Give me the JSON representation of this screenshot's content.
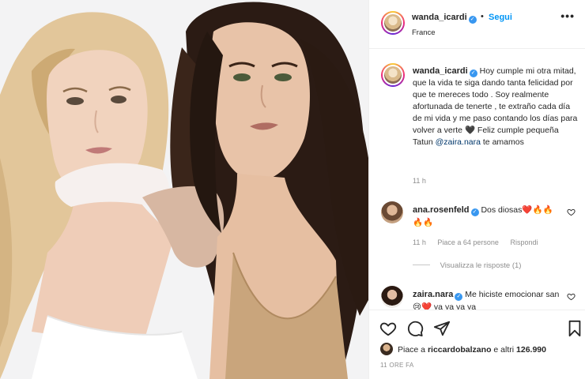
{
  "header": {
    "username": "wanda_icardi",
    "separator": "•",
    "follow_label": "Segui",
    "location": "France",
    "more_label": "•••"
  },
  "caption": {
    "username": "wanda_icardi",
    "text_before_mention": "Hoy cumple mi otra mitad, que la vida te siga dando tanta felicidad por que te mereces todo . Soy realmente afortunada de tenerte , te extraño cada día de mi vida y me paso contando los días para volver a verte 🖤 Feliz cumple pequeña Tatun",
    "mention": "@zaira.nara",
    "text_after_mention": "te amamos",
    "time": "11 h"
  },
  "comments": [
    {
      "username": "ana.rosenfeld",
      "text": "Dos diosas❤️🔥🔥🔥🔥",
      "time": "11 h",
      "likes": "Piace a 64 persone",
      "reply_label": "Rispondi",
      "view_replies": "Visualizza le risposte (1)"
    },
    {
      "username": "zaira.nara",
      "text": "Me hiciste emocionar san 😢❤️ ya ya ya ya"
    }
  ],
  "actions": {
    "likes_prefix": "Piace a",
    "likes_user": "riccardobalzano",
    "likes_suffix": "e altri",
    "likes_count": "126.990",
    "date": "11 ORE FA"
  },
  "colors": {
    "link_blue": "#0095f6",
    "verified_blue": "#3897f0",
    "muted": "#8e8e8e"
  },
  "icons": [
    "heart-icon",
    "comment-icon",
    "share-icon",
    "bookmark-icon",
    "verified-icon",
    "more-icon"
  ]
}
